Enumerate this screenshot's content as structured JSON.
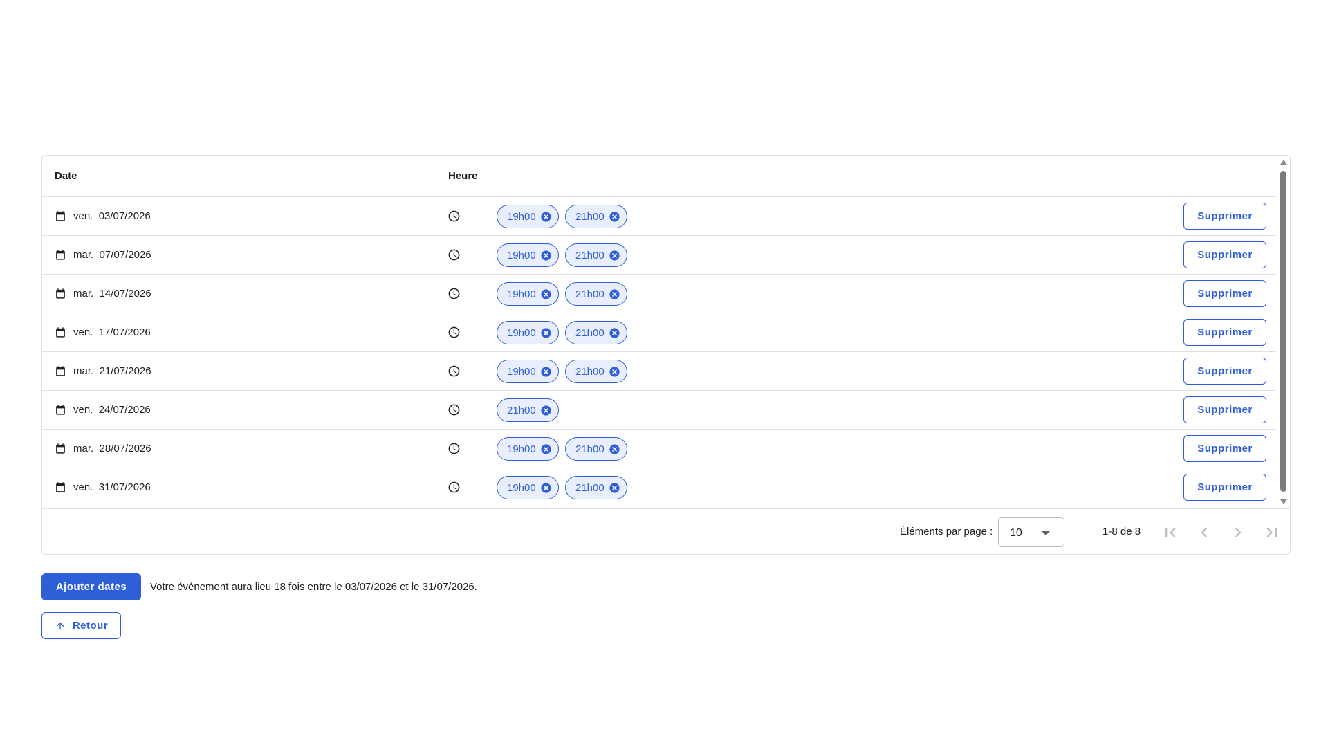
{
  "table": {
    "headers": {
      "date": "Date",
      "heure": "Heure"
    },
    "delete_label": "Supprimer",
    "rows": [
      {
        "day": "ven.",
        "date": "03/07/2026",
        "times": [
          "19h00",
          "21h00"
        ]
      },
      {
        "day": "mar.",
        "date": "07/07/2026",
        "times": [
          "19h00",
          "21h00"
        ]
      },
      {
        "day": "mar.",
        "date": "14/07/2026",
        "times": [
          "19h00",
          "21h00"
        ]
      },
      {
        "day": "ven.",
        "date": "17/07/2026",
        "times": [
          "19h00",
          "21h00"
        ]
      },
      {
        "day": "mar.",
        "date": "21/07/2026",
        "times": [
          "19h00",
          "21h00"
        ]
      },
      {
        "day": "ven.",
        "date": "24/07/2026",
        "times": [
          "21h00"
        ]
      },
      {
        "day": "mar.",
        "date": "28/07/2026",
        "times": [
          "19h00",
          "21h00"
        ]
      },
      {
        "day": "ven.",
        "date": "31/07/2026",
        "times": [
          "19h00",
          "21h00"
        ]
      }
    ]
  },
  "paginator": {
    "items_per_page_label": "Éléments par page :",
    "page_size": "10",
    "range_label": "1-8 de 8"
  },
  "actions": {
    "add_dates_label": "Ajouter dates",
    "summary": "Votre événement aura lieu 18 fois entre le 03/07/2026 et le 31/07/2026.",
    "back_label": "Retour"
  },
  "colors": {
    "primary": "#2f5fd6",
    "chip_bg": "#e8eefc",
    "border": "#e0e0e0",
    "disabled_icon": "#bdbdbd"
  },
  "icons": {
    "date_cell": "calendar-icon",
    "time_cell": "clock-icon",
    "chip_remove": "cancel-circle-icon",
    "back": "arrow-up-icon",
    "pager": [
      "first-page-icon",
      "chevron-left-icon",
      "chevron-right-icon",
      "last-page-icon"
    ]
  }
}
